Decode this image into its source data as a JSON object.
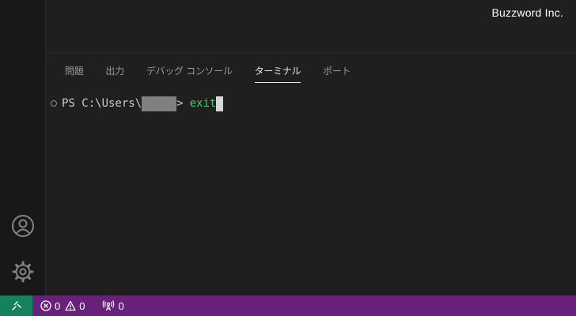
{
  "watermark": "Buzzword Inc.",
  "panel": {
    "tabs": [
      {
        "label": "問題",
        "active": false
      },
      {
        "label": "出力",
        "active": false
      },
      {
        "label": "デバッグ コンソール",
        "active": false
      },
      {
        "label": "ターミナル",
        "active": true
      },
      {
        "label": "ポート",
        "active": false
      }
    ]
  },
  "terminal": {
    "prompt_prefix": "PS C:\\Users\\",
    "prompt_suffix": ">",
    "command": "exit"
  },
  "status_bar": {
    "errors": "0",
    "warnings": "0",
    "ports": "0"
  },
  "colors": {
    "status_bar": "#68217a",
    "remote": "#16825d",
    "command": "#4ec971"
  },
  "icons": {
    "remote": "remote-icon",
    "accounts": "account-icon",
    "manage": "gear-icon",
    "errors": "error-icon",
    "warnings": "warning-icon",
    "ports": "ports-antenna-icon"
  }
}
